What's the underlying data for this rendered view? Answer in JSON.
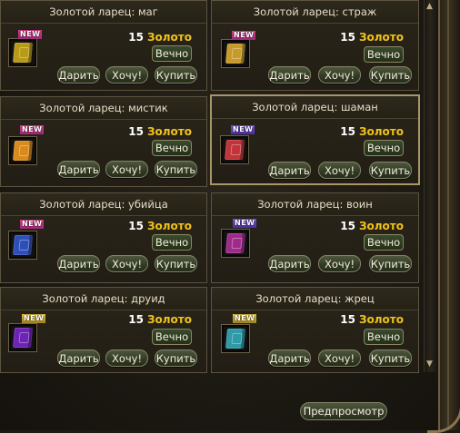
{
  "common": {
    "price_amount": "15",
    "currency": "Золото",
    "duration": "Вечно",
    "gift_label": "Дарить",
    "wish_label": "Хочу!",
    "buy_label": "Купить",
    "new_badge": "NEW"
  },
  "items": [
    {
      "title": "Золотой ларец: маг",
      "book_color": "#b89a18"
    },
    {
      "title": "Золотой ларец: страж",
      "book_color": "#c79a2a"
    },
    {
      "title": "Золотой ларец: мистик",
      "book_color": "#d98a1c"
    },
    {
      "title": "Золотой ларец: шаман",
      "book_color": "#c0343a"
    },
    {
      "title": "Золотой ларец: убийца",
      "book_color": "#2f4fb8"
    },
    {
      "title": "Золотой ларец: воин",
      "book_color": "#a02a8a"
    },
    {
      "title": "Золотой ларец: друид",
      "book_color": "#6d23b5"
    },
    {
      "title": "Золотой ларец: жрец",
      "book_color": "#2f9aa8"
    }
  ],
  "footer": {
    "preview_label": "Предпросмотр"
  },
  "colors": {
    "currency": "#f0c21c",
    "new_badge": "#e0408c"
  }
}
